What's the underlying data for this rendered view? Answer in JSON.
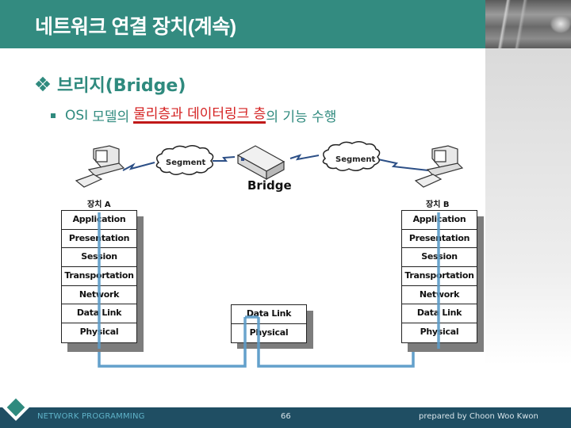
{
  "slide": {
    "title": "네트워크 연결 장치(계속)",
    "heading": "브리지(Bridge)",
    "bullet": {
      "prefix_words": [
        "OSI",
        "모델의"
      ],
      "highlighted": "물리층과 데이터링크 층",
      "suffix": "의 기능 수행"
    }
  },
  "diagram": {
    "device_a_label": "장치 A",
    "device_b_label": "장치 B",
    "bridge_label": "Bridge",
    "segment_left": "Segment",
    "segment_right": "Segment",
    "stack_a": [
      "Application",
      "Presentation",
      "Session",
      "Transportation",
      "Network",
      "Data Link",
      "Physical"
    ],
    "stack_bridge": [
      "Data Link",
      "Physical"
    ],
    "stack_b": [
      "Application",
      "Presentation",
      "Session",
      "Transportation",
      "Network",
      "Data Link",
      "Physical"
    ],
    "colors": {
      "wire": "#5b9bc8",
      "link": "#2c4f86",
      "accent": "#2f8a7e",
      "highlight": "#d42020"
    }
  },
  "footer": {
    "left": "NETWORK PROGRAMMING",
    "page": "66",
    "right": "prepared by Choon Woo Kwon"
  }
}
